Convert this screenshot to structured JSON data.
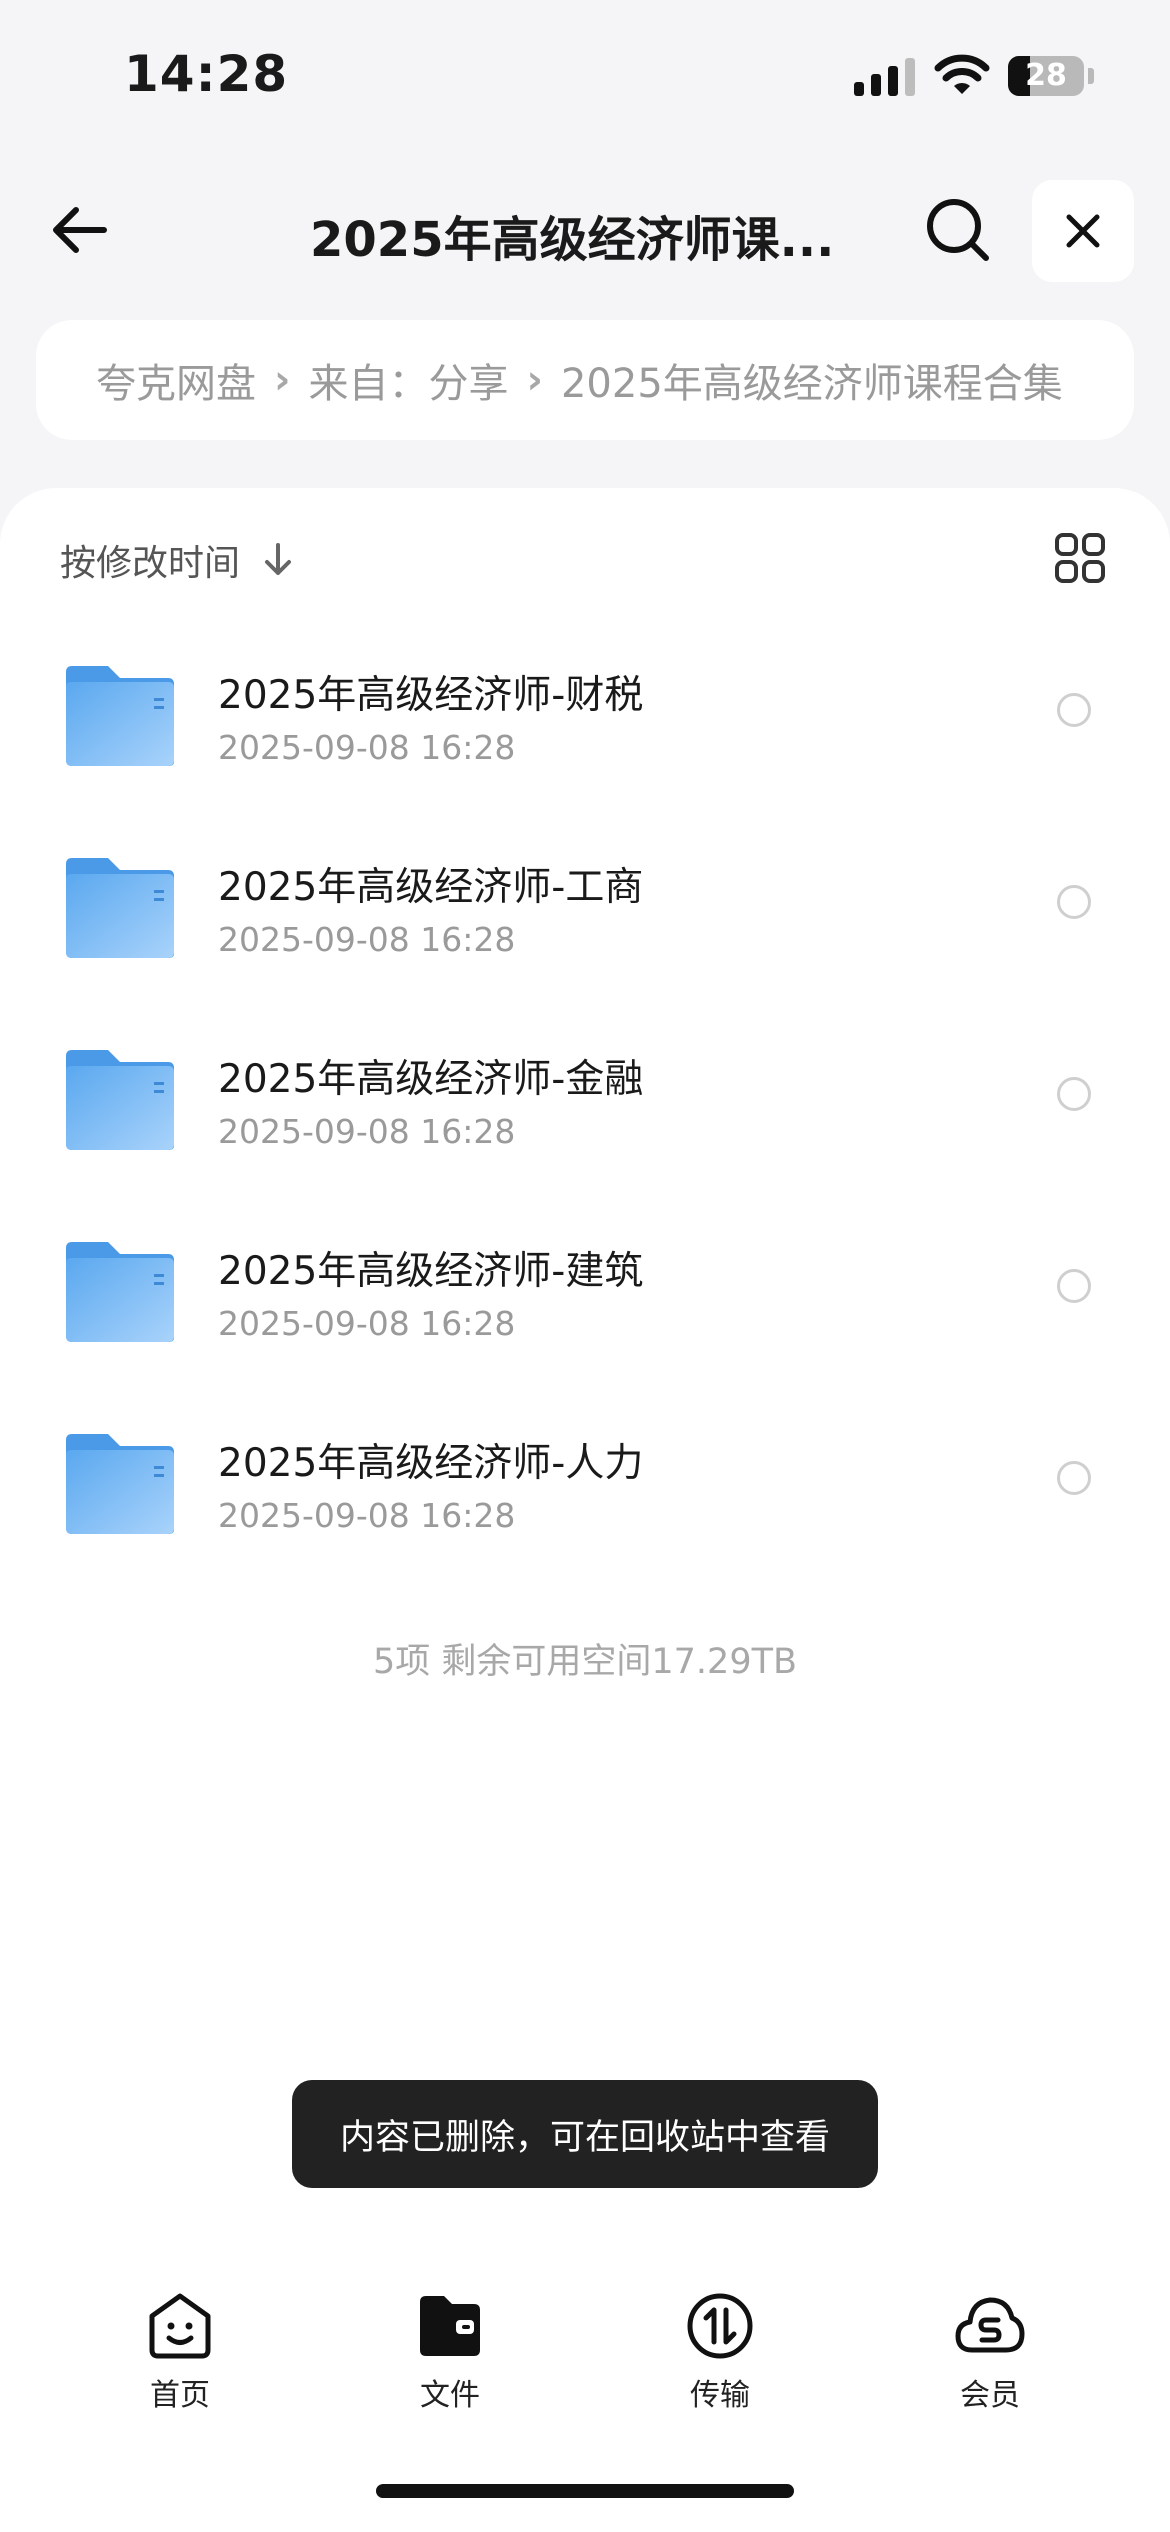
{
  "status_bar": {
    "time": "14:28",
    "battery": "28"
  },
  "nav": {
    "title": "2025年高级经济师课...",
    "back_icon": "arrow-left-icon",
    "search_icon": "search-icon",
    "close_icon": "close-icon"
  },
  "breadcrumb": {
    "items": [
      "夸克网盘",
      "来自：分享",
      "2025年高级经济师课程合集"
    ],
    "separator": "›"
  },
  "sort": {
    "label": "按修改时间",
    "arrow_icon": "arrow-down-icon",
    "view_icon": "grid-view-icon"
  },
  "files": [
    {
      "name": "2025年高级经济师-财税",
      "date": "2025-09-08 16:28"
    },
    {
      "name": "2025年高级经济师-工商",
      "date": "2025-09-08 16:28"
    },
    {
      "name": "2025年高级经济师-金融",
      "date": "2025-09-08 16:28"
    },
    {
      "name": "2025年高级经济师-建筑",
      "date": "2025-09-08 16:28"
    },
    {
      "name": "2025年高级经济师-人力",
      "date": "2025-09-08 16:28"
    }
  ],
  "footer_info": "5项 剩余可用空间17.29TB",
  "toast": "内容已删除，可在回收站中查看",
  "tabs": [
    {
      "label": "首页",
      "icon": "smiley-home-icon"
    },
    {
      "label": "文件",
      "icon": "folder-file-icon"
    },
    {
      "label": "传输",
      "icon": "transfer-icon"
    },
    {
      "label": "会员",
      "icon": "cloud-member-icon"
    }
  ],
  "colors": {
    "folder": "#6db3f2",
    "background": "#f5f5f7",
    "toast": "#222222"
  }
}
